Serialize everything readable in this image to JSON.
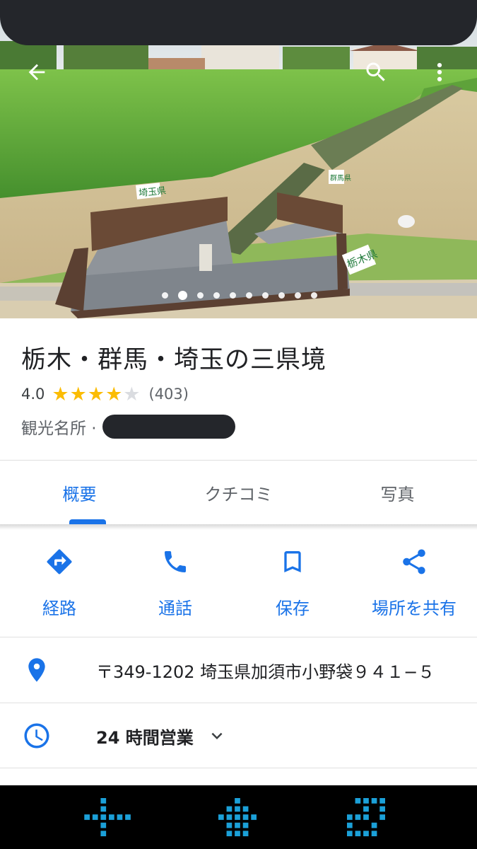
{
  "hero": {
    "photo_description_icon": "photo-rice-field-border",
    "dot_count": 10,
    "active_dot_index": 1,
    "sign_texts": [
      "埼玉県",
      "群馬県",
      "栃木県"
    ]
  },
  "place": {
    "title": "栃木・群馬・埼玉の三県境",
    "rating": "4.0",
    "rating_value": 4.0,
    "review_count": "(403)",
    "category": "観光名所 ·"
  },
  "tabs": [
    {
      "label": "概要",
      "active": true
    },
    {
      "label": "クチコミ",
      "active": false
    },
    {
      "label": "写真",
      "active": false
    }
  ],
  "actions": [
    {
      "label": "経路",
      "icon": "directions-icon"
    },
    {
      "label": "通話",
      "icon": "phone-icon"
    },
    {
      "label": "保存",
      "icon": "bookmark-icon"
    },
    {
      "label": "場所を共有",
      "icon": "share-icon"
    }
  ],
  "info": {
    "address": "〒349-1202 埼玉県加須市小野袋９４１−５",
    "hours": "24 時間営業"
  },
  "colors": {
    "accent": "#1a73e8",
    "star": "#fbbc04",
    "star_empty": "#dadce0",
    "navbar": "#000000",
    "nav_icon": "#1ba0d8"
  }
}
